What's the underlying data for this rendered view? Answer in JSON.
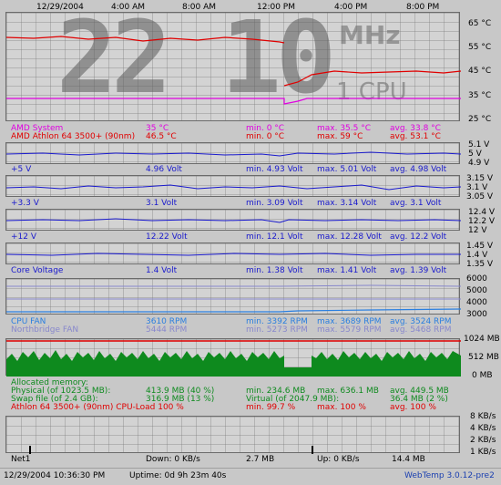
{
  "top_axis": {
    "date": "12/29/2004",
    "times": [
      "4:00 AM",
      "8:00 AM",
      "12:00 PM",
      "4:00 PM",
      "8:00 PM"
    ]
  },
  "big_display": {
    "value": "22 10",
    "unit": "MHz",
    "cpu": "1 CPU"
  },
  "temp_axis": [
    "65 °C",
    "55 °C",
    "45 °C",
    "35 °C",
    "25 °C"
  ],
  "temps": [
    {
      "name": "AMD System",
      "value": "35 °C",
      "min": "min. 0 °C",
      "max": "max. 35.5 °C",
      "avg": "avg. 33.8 °C",
      "color": "#e000e0"
    },
    {
      "name": "AMD Athlon 64 3500+ (90nm)",
      "value": "46.5 °C",
      "min": "min. 0 °C",
      "max": "max. 59 °C",
      "avg": "avg. 53.1 °C",
      "color": "#e00000"
    }
  ],
  "volts": [
    {
      "name": "+5 V",
      "value": "4.96 Volt",
      "min": "min. 4.93 Volt",
      "max": "max. 5.01 Volt",
      "avg": "avg. 4.98 Volt",
      "axis": [
        "5.1 V",
        "5 V",
        "4.9 V"
      ]
    },
    {
      "name": "+3.3 V",
      "value": "3.1 Volt",
      "min": "min. 3.09 Volt",
      "max": "max. 3.14 Volt",
      "avg": "avg. 3.1 Volt",
      "axis": [
        "3.15 V",
        "3.1 V",
        "3.05 V"
      ]
    },
    {
      "name": "+12 V",
      "value": "12.22 Volt",
      "min": "min. 12.1 Volt",
      "max": "max. 12.28 Volt",
      "avg": "avg. 12.2 Volt",
      "axis": [
        "12.4 V",
        "12.2 V",
        "12 V"
      ]
    },
    {
      "name": "Core Voltage",
      "value": "1.4 Volt",
      "min": "min. 1.38 Volt",
      "max": "max. 1.41 Volt",
      "avg": "avg. 1.39 Volt",
      "axis": [
        "1.45 V",
        "1.4 V",
        "1.35 V"
      ]
    }
  ],
  "volt_color": "#1a1acd",
  "fans": [
    {
      "name": "CPU FAN",
      "value": "3610 RPM",
      "min": "min. 3392 RPM",
      "max": "max. 3689 RPM",
      "avg": "avg. 3524 RPM",
      "color": "#2a7fe0"
    },
    {
      "name": "Northbridge FAN",
      "value": "5444 RPM",
      "min": "min. 5273 RPM",
      "max": "max. 5579 RPM",
      "avg": "avg. 5468 RPM",
      "color": "#8888cc"
    }
  ],
  "fan_axis": [
    "6000",
    "5000",
    "4000",
    "3000"
  ],
  "memory": {
    "axis": [
      "1024 MB",
      "512 MB",
      "0 MB"
    ],
    "title": "Allocated memory:",
    "physical": {
      "label": "Physical (of 1023.5 MB):",
      "value": "413.9 MB (40 %)",
      "min": "min. 234.6 MB",
      "max": "max. 636.1 MB",
      "avg": "avg. 449.5 MB"
    },
    "swap": {
      "label": "Swap file (of 2.4 GB):",
      "value": "316.9 MB (13 %)",
      "virtual": "Virtual (of 2047.9 MB):",
      "max": "36.4 MB (2 %)"
    },
    "cpuload": {
      "label": "Athlon 64 3500+ (90nm) CPU-Load 100 %",
      "min": "min. 99.7 %",
      "max": "max. 100 %",
      "avg": "avg. 100 %"
    },
    "green": "#0e8a1e",
    "red": "#e00000"
  },
  "net": {
    "axis": [
      "8 KB/s",
      "4 KB/s",
      "2 KB/s",
      "1 KB/s"
    ],
    "name": "Net1",
    "down": "Down: 0 KB/s",
    "down_total": "2.7 MB",
    "up": "Up: 0 KB/s",
    "up_total": "14.4 MB"
  },
  "footer": {
    "datetime": "12/29/2004 10:36:30 PM",
    "uptime": "Uptime: 0d 9h 23m 40s",
    "app": "WebTemp 3.0.12-pre2"
  }
}
